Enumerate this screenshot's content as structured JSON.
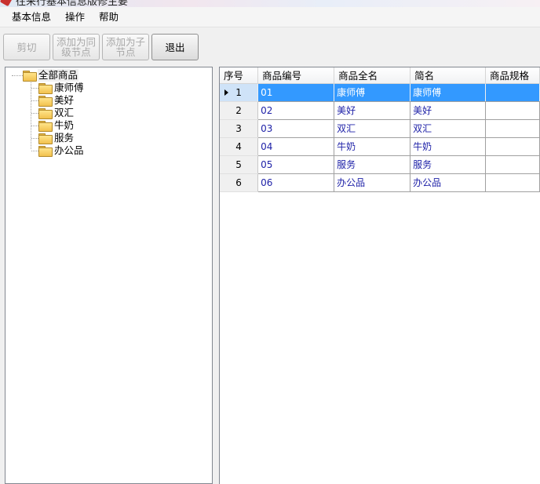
{
  "window": {
    "title": "往来行基本信息版修主要"
  },
  "menu": [
    "基本信息",
    "操作",
    "帮助"
  ],
  "toolbar": {
    "buttons": [
      {
        "label": "剪切",
        "enabled": false
      },
      {
        "label": "添加为同级节点",
        "enabled": false
      },
      {
        "label": "添加为子节点",
        "enabled": false
      },
      {
        "label": "退出",
        "enabled": true
      }
    ]
  },
  "tree": {
    "root": "全部商品",
    "children": [
      "康师傅",
      "美好",
      "双汇",
      "牛奶",
      "服务",
      "办公品"
    ]
  },
  "grid": {
    "columns": [
      "序号",
      "商品编号",
      "商品全名",
      "简名",
      "商品规格"
    ],
    "selected_row": 0,
    "rows": [
      {
        "no": "1",
        "code": "01",
        "fullname": "康师傅",
        "short": "康师傅",
        "spec": ""
      },
      {
        "no": "2",
        "code": "02",
        "fullname": "美好",
        "short": "美好",
        "spec": ""
      },
      {
        "no": "3",
        "code": "03",
        "fullname": "双汇",
        "short": "双汇",
        "spec": ""
      },
      {
        "no": "4",
        "code": "04",
        "fullname": "牛奶",
        "short": "牛奶",
        "spec": ""
      },
      {
        "no": "5",
        "code": "05",
        "fullname": "服务",
        "short": "服务",
        "spec": ""
      },
      {
        "no": "6",
        "code": "06",
        "fullname": "办公品",
        "short": "办公品",
        "spec": ""
      }
    ]
  },
  "icons": {
    "app": "app-icon",
    "folder": "folder-icon",
    "current_row": "row-pointer-icon"
  },
  "colors": {
    "selection": "#3399ff",
    "cell_text": "#1f22a8"
  }
}
